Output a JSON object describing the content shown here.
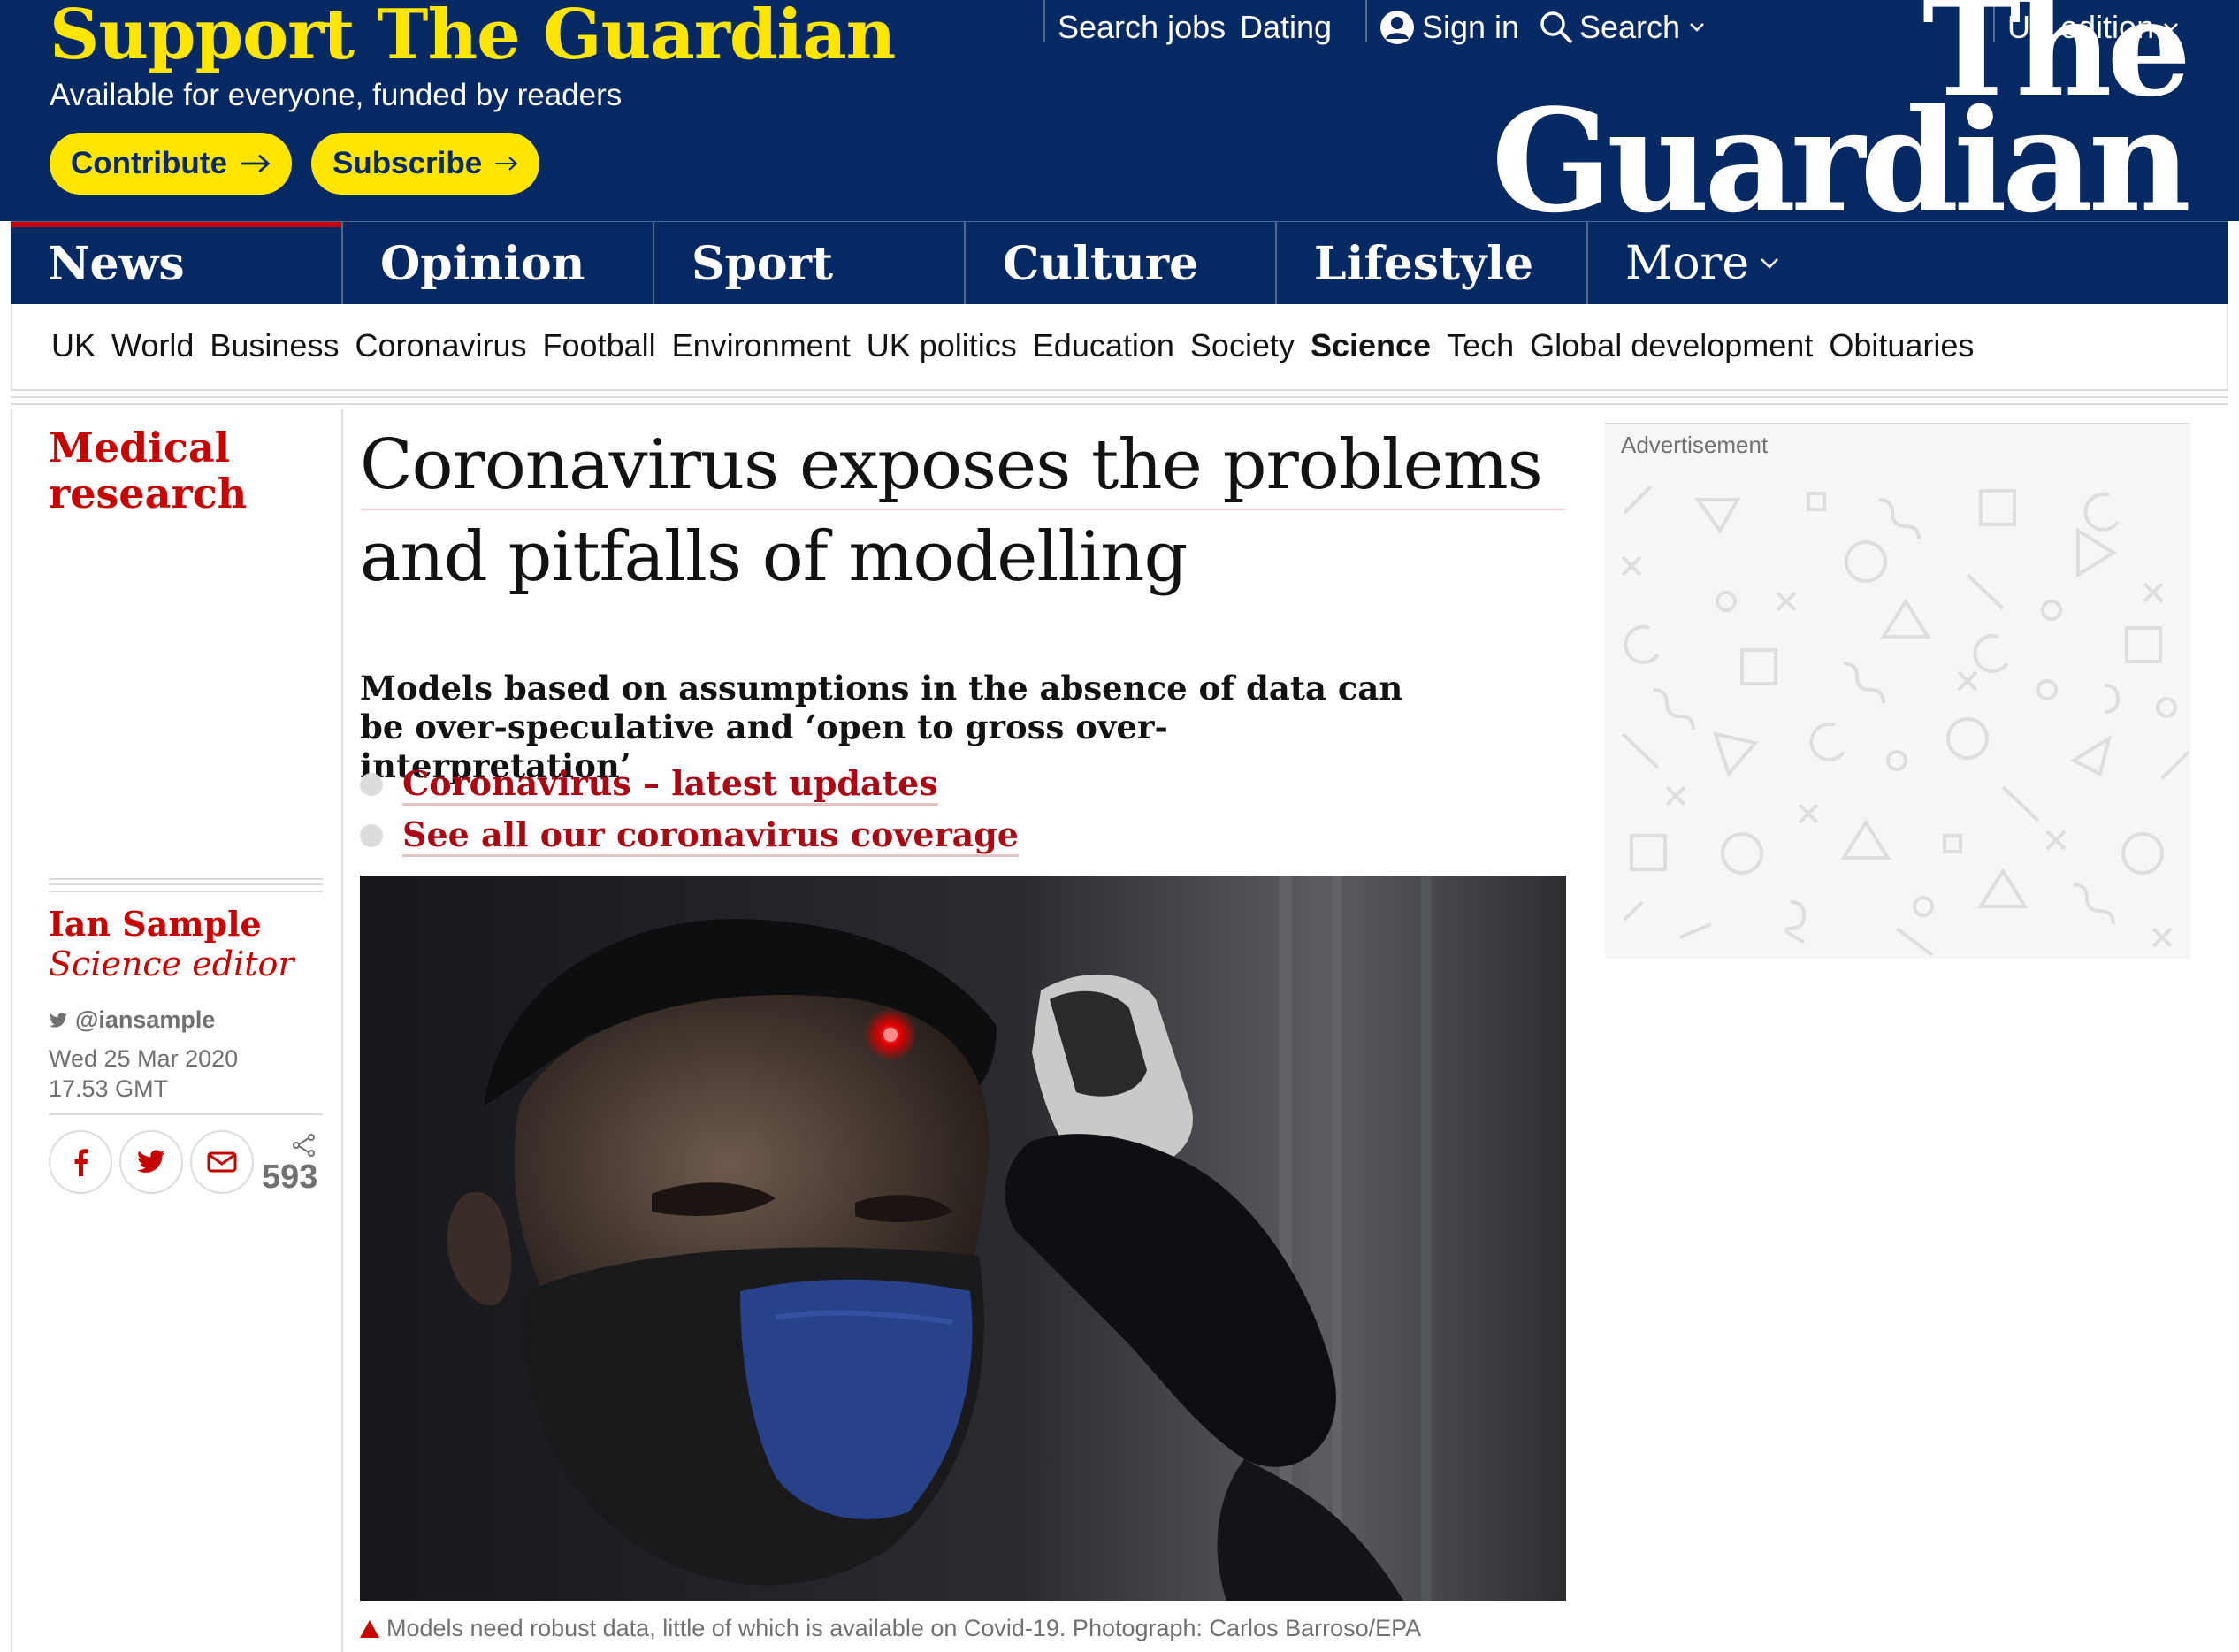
{
  "header": {
    "support_title": "Support The Guardian",
    "support_subtitle": "Available for everyone, funded by readers",
    "contribute_label": "Contribute",
    "subscribe_label": "Subscribe",
    "search_jobs": "Search jobs",
    "dating": "Dating",
    "sign_in": "Sign in",
    "search": "Search",
    "edition": "UK edition",
    "logo_line1": "The",
    "logo_line2": "Guardian",
    "brand_color": "#052962",
    "accent_yellow": "#ffe500"
  },
  "nav": {
    "pillars": [
      {
        "label": "News"
      },
      {
        "label": "Opinion"
      },
      {
        "label": "Sport"
      },
      {
        "label": "Culture"
      },
      {
        "label": "Lifestyle"
      }
    ],
    "more_label": "More",
    "active_color": "#c70000"
  },
  "subnav": {
    "items": [
      "UK",
      "World",
      "Business",
      "Coronavirus",
      "Football",
      "Environment",
      "UK politics",
      "Education",
      "Society",
      "Science",
      "Tech",
      "Global development",
      "Obituaries"
    ],
    "active": "Science"
  },
  "article": {
    "section": "Medical research",
    "headline": "Coronavirus exposes the problems and pitfalls of modelling",
    "standfirst": "Models based on assumptions in the absence of data can be over-speculative and ‘open to gross over-interpretation’",
    "links": [
      "Coronavirus – latest updates",
      "See all our coronavirus coverage"
    ],
    "author": "Ian Sample",
    "author_role": "Science editor",
    "twitter": "@iansample",
    "date": "Wed 25 Mar 2020",
    "time": "17.53 GMT",
    "share_count": "593",
    "caption": "Models need robust data, little of which is available on Covid-19. Photograph: Carlos Barroso/EPA",
    "accent_red": "#c70000"
  },
  "ad": {
    "label": "Advertisement"
  },
  "icons": [
    "arrow-right-icon",
    "profile-icon",
    "search-icon",
    "chevron-down-icon",
    "twitter-icon",
    "facebook-icon",
    "email-icon",
    "share-icon"
  ]
}
